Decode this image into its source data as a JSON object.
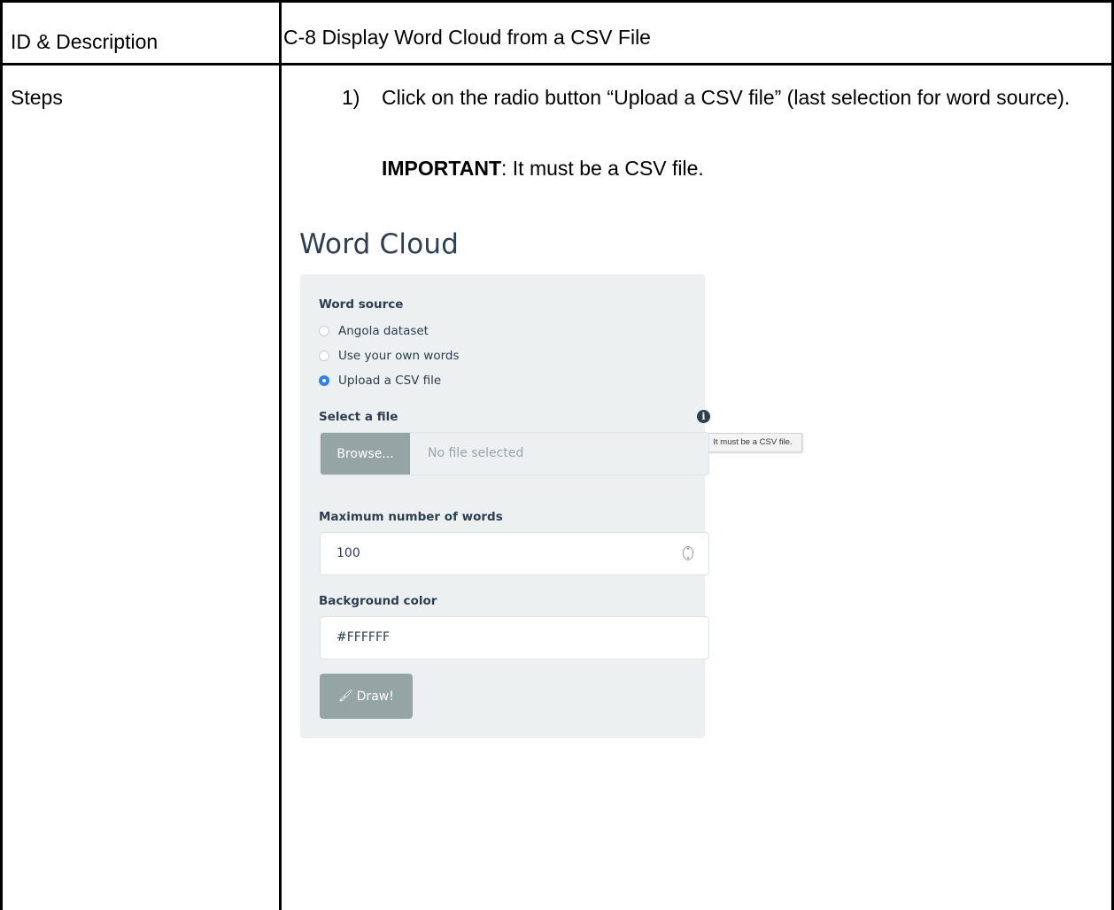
{
  "table": {
    "row1_label": "ID & Description",
    "row1_value": "C-8 Display Word Cloud from a CSV File",
    "row2_label": "Steps",
    "step_number": "1)",
    "step_text": "Click on the radio button “Upload a CSV file” (last selection for word source).",
    "important_label": "IMPORTANT",
    "important_text": ": It must be a CSV file."
  },
  "app": {
    "title": "Word Cloud",
    "word_source_label": "Word source",
    "radio_options": [
      {
        "label": "Angola dataset",
        "checked": false
      },
      {
        "label": "Use your own words",
        "checked": false
      },
      {
        "label": "Upload a CSV file",
        "checked": true
      }
    ],
    "select_file_label": "Select a file",
    "info_icon": "info-circle-icon",
    "tooltip": "It must be a CSV file.",
    "browse_label": "Browse...",
    "file_placeholder": "No file selected",
    "max_words_label": "Maximum number of words",
    "max_words_value": "100",
    "bg_color_label": "Background color",
    "bg_color_value": "#FFFFFF",
    "draw_label": "Draw!",
    "draw_icon": "paint-brush-icon"
  }
}
